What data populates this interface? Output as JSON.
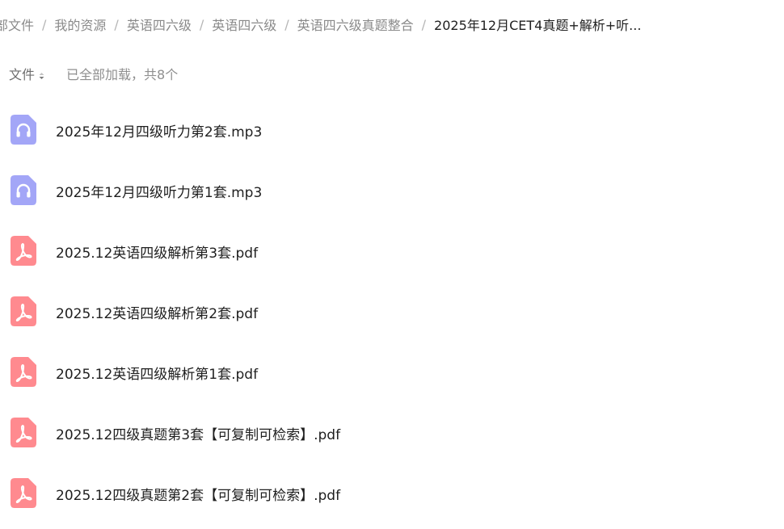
{
  "breadcrumb": {
    "items": [
      {
        "label": "部文件"
      },
      {
        "label": "我的资源"
      },
      {
        "label": "英语四六级"
      },
      {
        "label": "英语四六级"
      },
      {
        "label": "英语四六级真题整合"
      },
      {
        "label": "2025年12月CET4真题+解析+听..."
      }
    ],
    "separator": "/"
  },
  "toolbar": {
    "sort_label": "文件",
    "status_text": "已全部加载，共8个"
  },
  "files": [
    {
      "name": "2025年12月四级听力第2套.mp3",
      "type": "audio",
      "icon": "headphones-icon"
    },
    {
      "name": "2025年12月四级听力第1套.mp3",
      "type": "audio",
      "icon": "headphones-icon"
    },
    {
      "name": "2025.12英语四级解析第3套.pdf",
      "type": "pdf",
      "icon": "pdf-icon"
    },
    {
      "name": "2025.12英语四级解析第2套.pdf",
      "type": "pdf",
      "icon": "pdf-icon"
    },
    {
      "name": "2025.12英语四级解析第1套.pdf",
      "type": "pdf",
      "icon": "pdf-icon"
    },
    {
      "name": "2025.12四级真题第3套【可复制可检索】.pdf",
      "type": "pdf",
      "icon": "pdf-icon"
    },
    {
      "name": "2025.12四级真题第2套【可复制可检索】.pdf",
      "type": "pdf",
      "icon": "pdf-icon"
    }
  ],
  "colors": {
    "audio_icon": "#a3a6f7",
    "pdf_icon": "#ff8a8f",
    "text_primary": "#1f1f1f",
    "text_muted": "#8a8a8a"
  }
}
